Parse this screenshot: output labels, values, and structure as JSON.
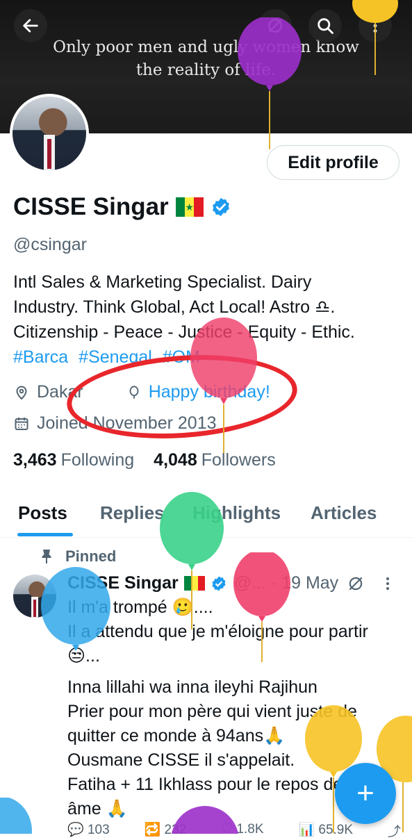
{
  "banner": {
    "quote_line1": "Only poor men and ugly women know",
    "quote_line2": "the reality of life."
  },
  "profile": {
    "name": "CISSE Singar",
    "handle": "@csingar",
    "edit_label": "Edit profile",
    "bio_line1": "Intl Sales & Marketing Specialist. Dairy",
    "bio_line2": "Industry. Think Global, Act Local! Astro ♎.",
    "bio_line3": "Citizenship - Peace - Justice - Equity - Ethic.",
    "tags": [
      "#Barca",
      "#Senegal",
      "#OM"
    ],
    "location": "Dakar",
    "birthday": "Happy birthday!",
    "joined": "Joined November 2013",
    "following_count": "3,463",
    "following_label": "Following",
    "followers_count": "4,048",
    "followers_label": "Followers"
  },
  "tabs": [
    "Posts",
    "Replies",
    "Highlights",
    "Articles"
  ],
  "post": {
    "pinned_label": "Pinned",
    "name": "CISSE Singar",
    "meta": "@... · 19 May",
    "lines": [
      "Il m'a trompé 🥲....",
      "Il a attendu que je m'éloigne pour partir",
      "😒...",
      "Inna lillahi wa inna ileyhi Rajihun",
      "Prier pour mon père qui vient juste de",
      "quitter ce monde à 94ans🙏",
      "Ousmane CISSE il s'appelait.",
      "Fatiha + 11 Ikhlass pour le repos de son",
      "âme 🙏"
    ],
    "replies": "103",
    "reposts": "232",
    "likes": "1.8K",
    "views": "65.9K"
  },
  "fab_label": "+",
  "colors": {
    "accent": "#1d9bf0",
    "annotation": "#e8262b"
  }
}
